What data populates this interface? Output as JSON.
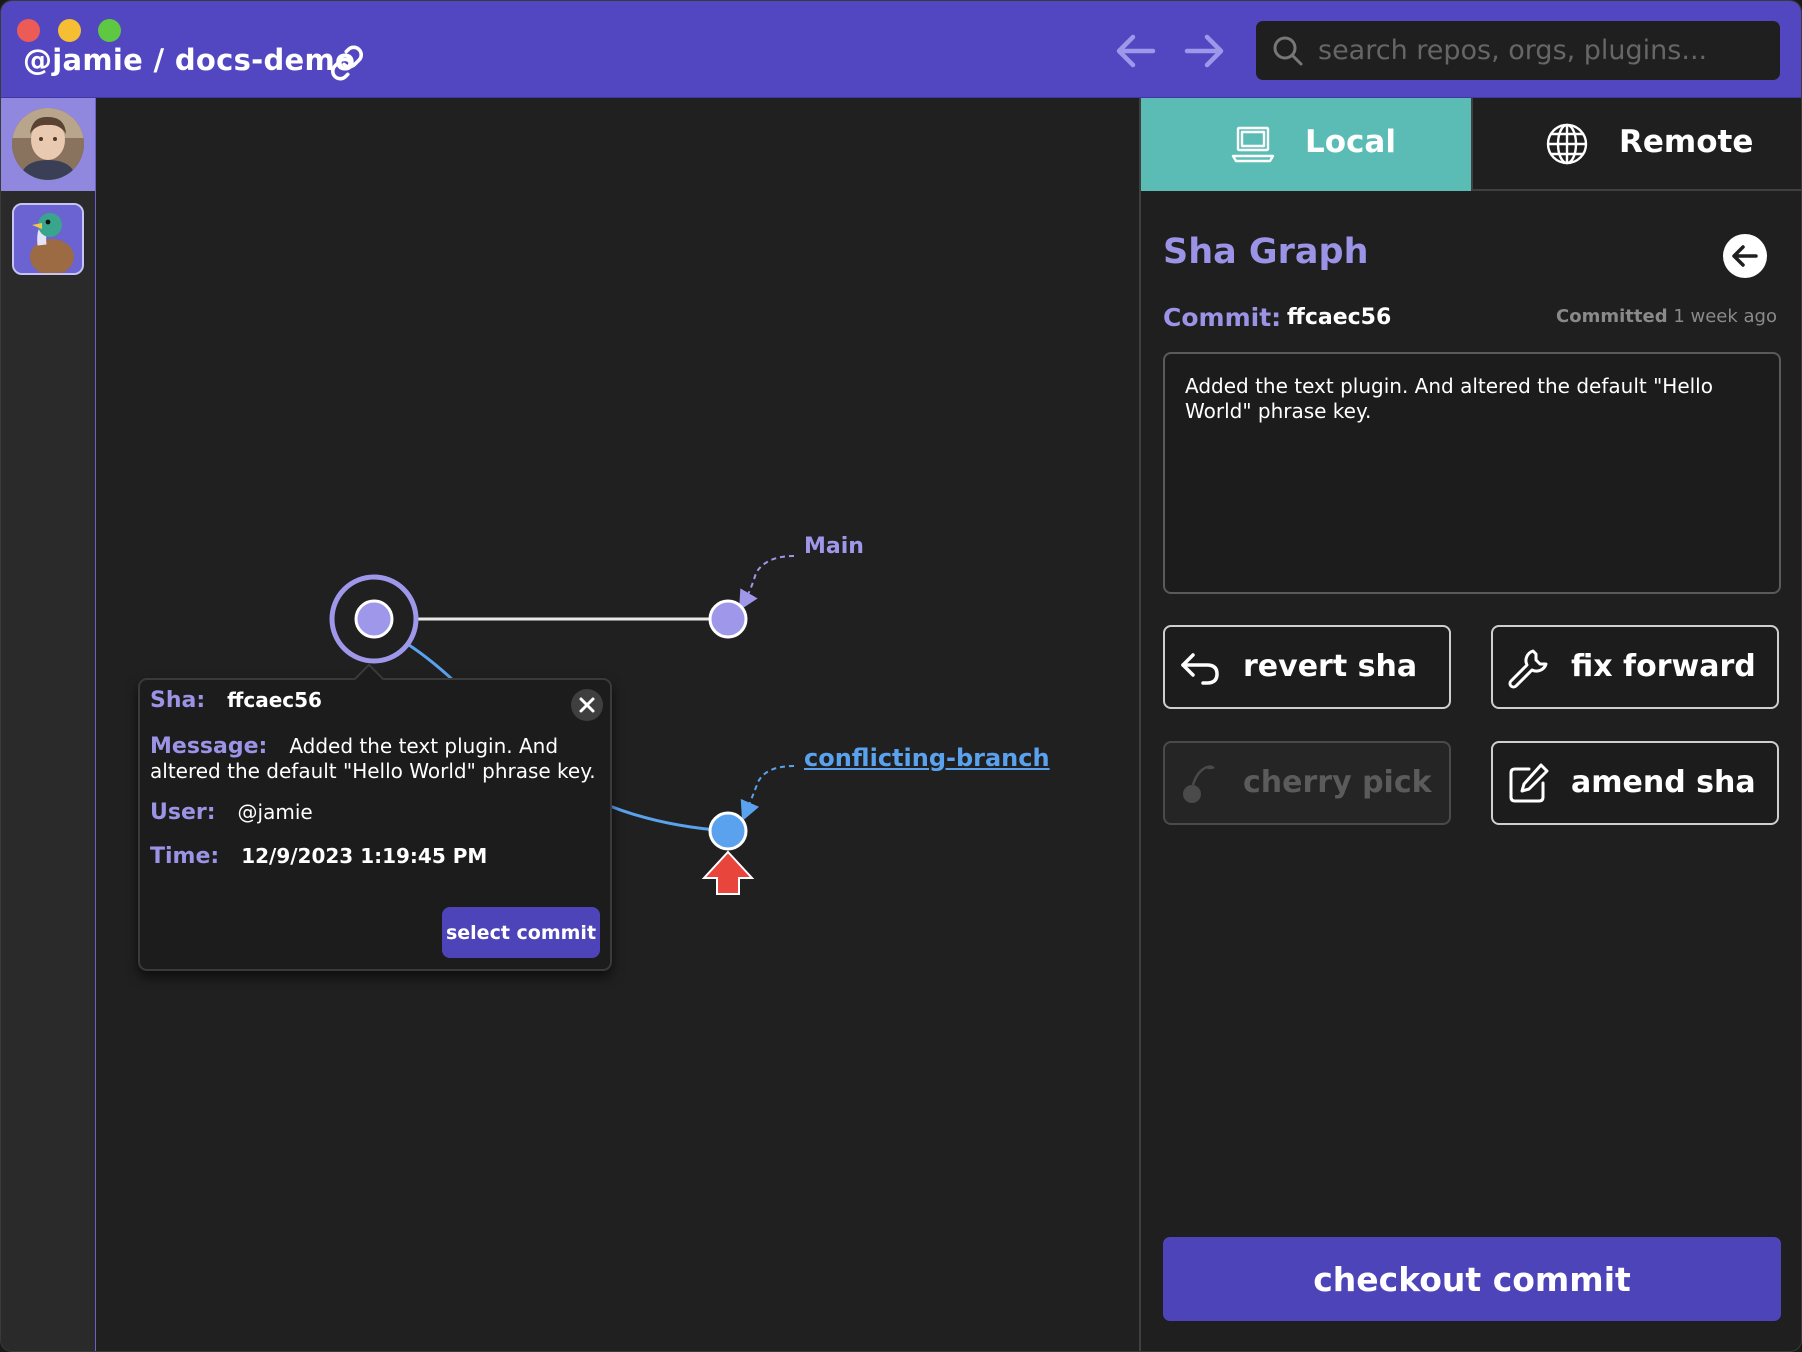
{
  "titlebar": {
    "repo_title": "@jamie / docs-demo",
    "search_placeholder": "search repos, orgs, plugins..."
  },
  "graph": {
    "branches": [
      {
        "name": "Main",
        "color": "#9f98ea"
      },
      {
        "name": "conflicting-branch",
        "color": "#5ba2ee"
      }
    ]
  },
  "popover": {
    "sha_key": "Sha:",
    "sha_value": "ffcaec56",
    "message_key": "Message:",
    "message_value": "Added the text plugin. And altered the default \"Hello World\" phrase key.",
    "user_key": "User:",
    "user_value": "@jamie",
    "time_key": "Time:",
    "time_value": "12/9/2023 1:19:45 PM",
    "select_label": "select commit"
  },
  "panel": {
    "tabs": [
      {
        "label": "Local",
        "icon": "laptop-icon",
        "active": true
      },
      {
        "label": "Remote",
        "icon": "globe-icon",
        "active": false
      }
    ],
    "title": "Sha Graph",
    "commit_key": "Commit:",
    "commit_value": "ffcaec56",
    "committed_label": "Committed",
    "committed_time": "1 week ago",
    "message": "Added the text plugin. And altered the default \"Hello World\" phrase key.",
    "actions": {
      "revert": "revert sha",
      "fix_forward": "fix forward",
      "cherry_pick": "cherry pick",
      "amend": "amend sha"
    },
    "checkout_label": "checkout commit"
  },
  "colors": {
    "accent": "#5247c1",
    "button": "#4e44b9",
    "local_tab": "#5bbcb5",
    "lavender": "#9b93e5",
    "branch_blue": "#5ba2ee",
    "warning_arrow": "#e8453c"
  }
}
